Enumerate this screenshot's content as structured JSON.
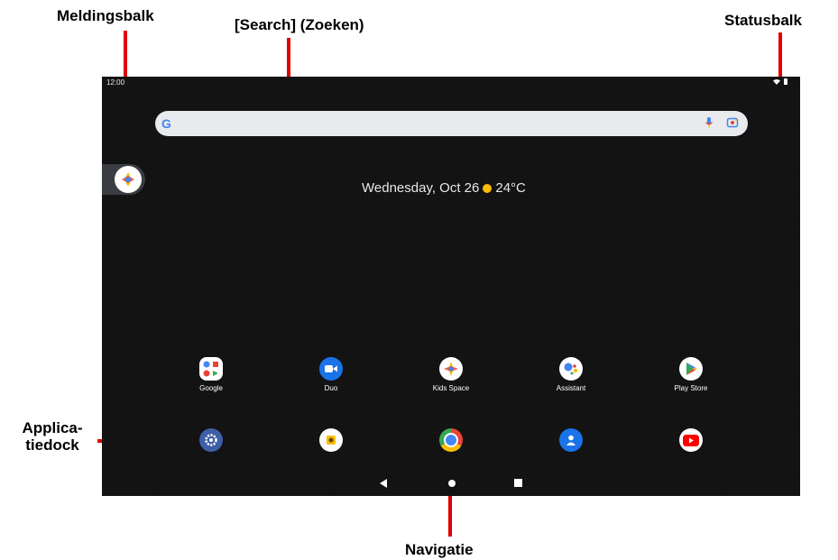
{
  "callouts": {
    "notification_bar": "Meldingsbalk",
    "search": "[Search] (Zoeken)",
    "status_bar": "Statusbalk",
    "app_dock_line1": "Applica-",
    "app_dock_line2": "tiedock",
    "navigation": "Navigatie"
  },
  "statusbar": {
    "time": "12:00"
  },
  "searchbar": {
    "logo": "G"
  },
  "widget": {
    "date": "Wednesday, Oct 26",
    "temperature": "24°C"
  },
  "apps_row1": [
    {
      "label": "Google",
      "icon": "google-folder-icon"
    },
    {
      "label": "Duo",
      "icon": "duo-icon"
    },
    {
      "label": "Kids Space",
      "icon": "kids-space-icon"
    },
    {
      "label": "Assistant",
      "icon": "assistant-icon"
    },
    {
      "label": "Play Store",
      "icon": "play-store-icon"
    }
  ],
  "dock_icons": [
    "settings-icon",
    "camera-icon",
    "chrome-icon",
    "contacts-icon",
    "youtube-icon"
  ],
  "colors": {
    "accent_red": "#e00000",
    "screen_bg": "#111111",
    "google_blue": "#4285f4"
  }
}
